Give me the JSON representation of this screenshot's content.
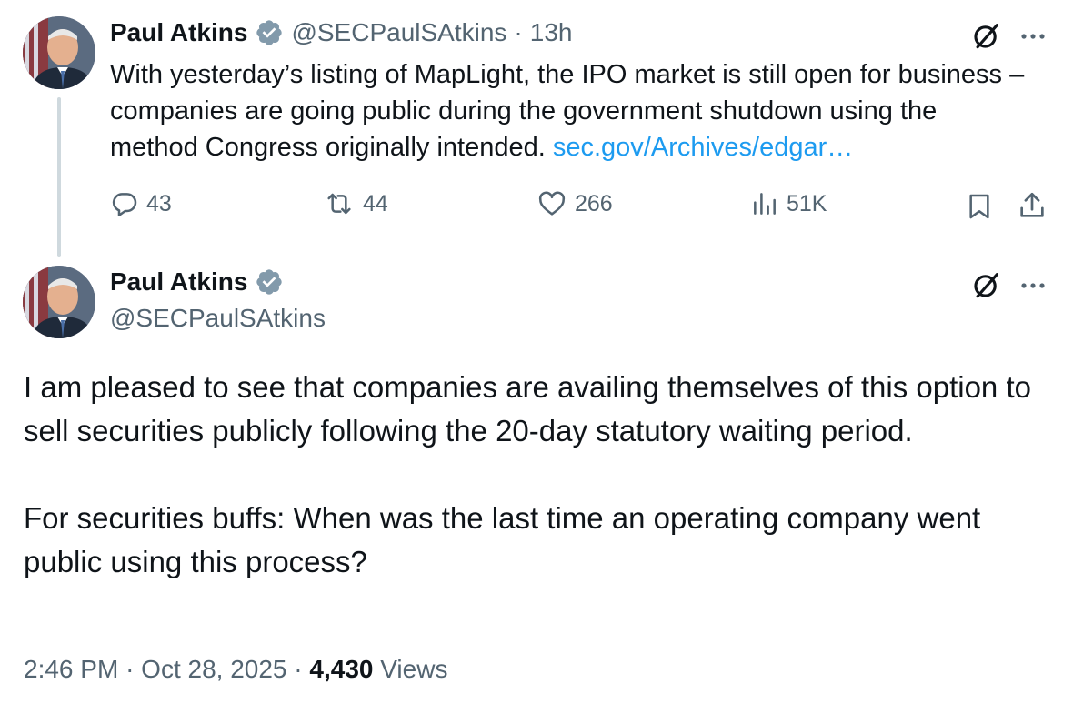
{
  "parent_tweet": {
    "author_name": "Paul Atkins",
    "author_handle": "@SECPaulSAtkins",
    "separator": "·",
    "time_ago": "13h",
    "text": "With yesterday’s listing of MapLight, the IPO market is still open for business – companies are going public during the government shutdown using the method Congress originally intended.",
    "link_text": "sec.gov/Archives/edgar…",
    "replies": "43",
    "reposts": "44",
    "likes": "266",
    "views": "51K"
  },
  "main_tweet": {
    "author_name": "Paul Atkins",
    "author_handle": "@SECPaulSAtkins",
    "paragraph_1": "I am pleased to see that companies are availing themselves of this option to sell securities publicly following the 20-day statutory waiting period.",
    "paragraph_2": "For securities buffs: When was the last time an operating company went public using this process?",
    "time": "2:46 PM",
    "dot": "·",
    "date": "Oct 28, 2025",
    "view_count": "4,430",
    "views_label": "Views"
  },
  "colors": {
    "text": "#0f1419",
    "secondary": "#536471",
    "link": "#1d9bf0",
    "verified": "#829aab",
    "thread_line": "#cfd9de"
  },
  "icons": [
    "grok-icon",
    "more-icon",
    "reply-icon",
    "repost-icon",
    "like-icon",
    "views-icon",
    "bookmark-icon",
    "share-icon",
    "verified-badge-icon"
  ]
}
